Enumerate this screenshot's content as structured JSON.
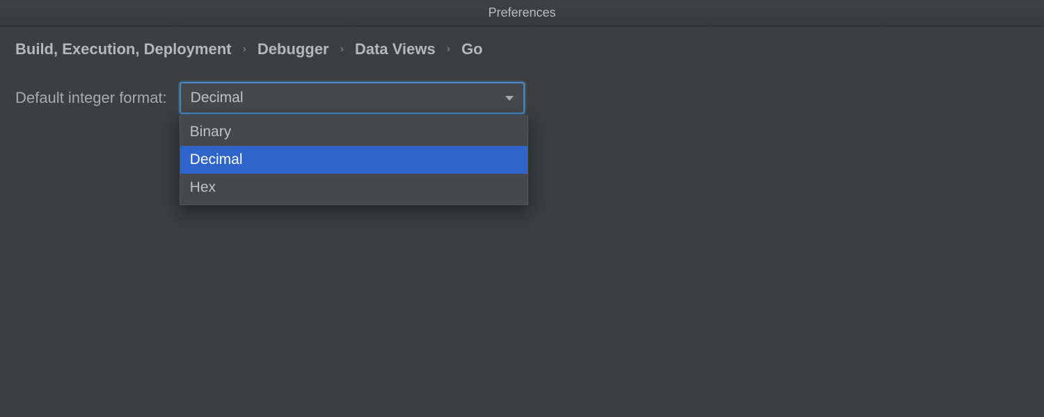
{
  "window": {
    "title": "Preferences"
  },
  "breadcrumb": {
    "items": [
      "Build, Execution, Deployment",
      "Debugger",
      "Data Views",
      "Go"
    ],
    "separator": "›"
  },
  "form": {
    "default_integer_format": {
      "label": "Default integer format:",
      "value": "Decimal",
      "options": [
        "Binary",
        "Decimal",
        "Hex"
      ],
      "selected_index": 1
    }
  }
}
